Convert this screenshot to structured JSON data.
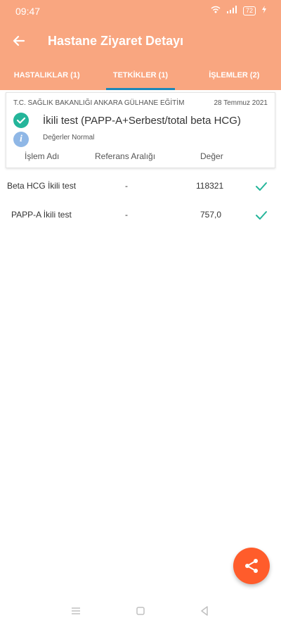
{
  "status_bar": {
    "time": "09:47",
    "battery": "72"
  },
  "app_bar": {
    "title": "Hastane Ziyaret Detayı",
    "back_icon": "arrow-left-icon"
  },
  "tabs": [
    {
      "label": "HASTALIKLAR (1)",
      "active": false
    },
    {
      "label": "TETKİKLER (1)",
      "active": true
    },
    {
      "label": "İŞLEMLER (2)",
      "active": false
    }
  ],
  "card": {
    "institution": "T.C. SAĞLIK BAKANLIĞI ANKARA GÜLHANE EĞİTİM",
    "date": "28 Temmuz 2021",
    "test_name": "İkili test (PAPP-A+Serbest/total beta HCG)",
    "status_text": "Değerler Normal",
    "headers": {
      "name": "İşlem Adı",
      "reference": "Referans Aralığı",
      "value": "Değer"
    }
  },
  "results": [
    {
      "name": "Beta HCG İkili test",
      "reference": "-",
      "value": "118321"
    },
    {
      "name": "PAPP-A İkili test",
      "reference": "-",
      "value": "757,0"
    }
  ],
  "colors": {
    "header": "#f9a680",
    "tab_indicator": "#1e88b8",
    "check": "#24b59a",
    "info": "#8fb7e6",
    "fab": "#ff5c2b"
  }
}
